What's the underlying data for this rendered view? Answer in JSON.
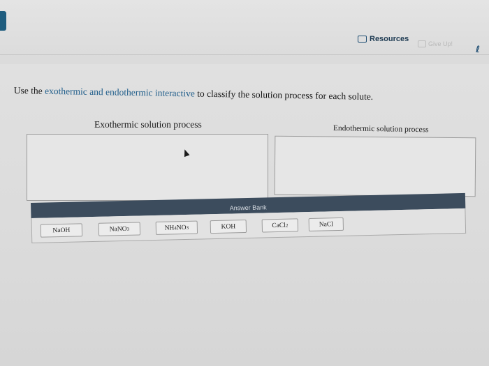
{
  "header": {
    "resources_label": "Resources",
    "giveup_label": "Give Up!",
    "hint_symbol": "ℓ"
  },
  "instruction": {
    "prefix": "Use the ",
    "link_text": "exothermic and endothermic interactive",
    "suffix": " to classify the solution process for each solute."
  },
  "categories": {
    "exothermic_label": "Exothermic solution process",
    "endothermic_label": "Endothermic solution process"
  },
  "answer_bank": {
    "title": "Answer Bank",
    "items": [
      {
        "base": "NaOH",
        "sub": "",
        "tail": ""
      },
      {
        "base": "NaNO",
        "sub": "3",
        "tail": ""
      },
      {
        "base": "NH",
        "sub": "4",
        "tail": "NO",
        "sub2": "3"
      },
      {
        "base": "KOH",
        "sub": "",
        "tail": ""
      },
      {
        "base": "CaCl",
        "sub": "2",
        "tail": ""
      },
      {
        "base": "NaCl",
        "sub": "",
        "tail": ""
      }
    ]
  },
  "colors": {
    "brand": "#1f5d7f",
    "link": "#1f5d8a",
    "bank_header": "#3c4c5d"
  }
}
